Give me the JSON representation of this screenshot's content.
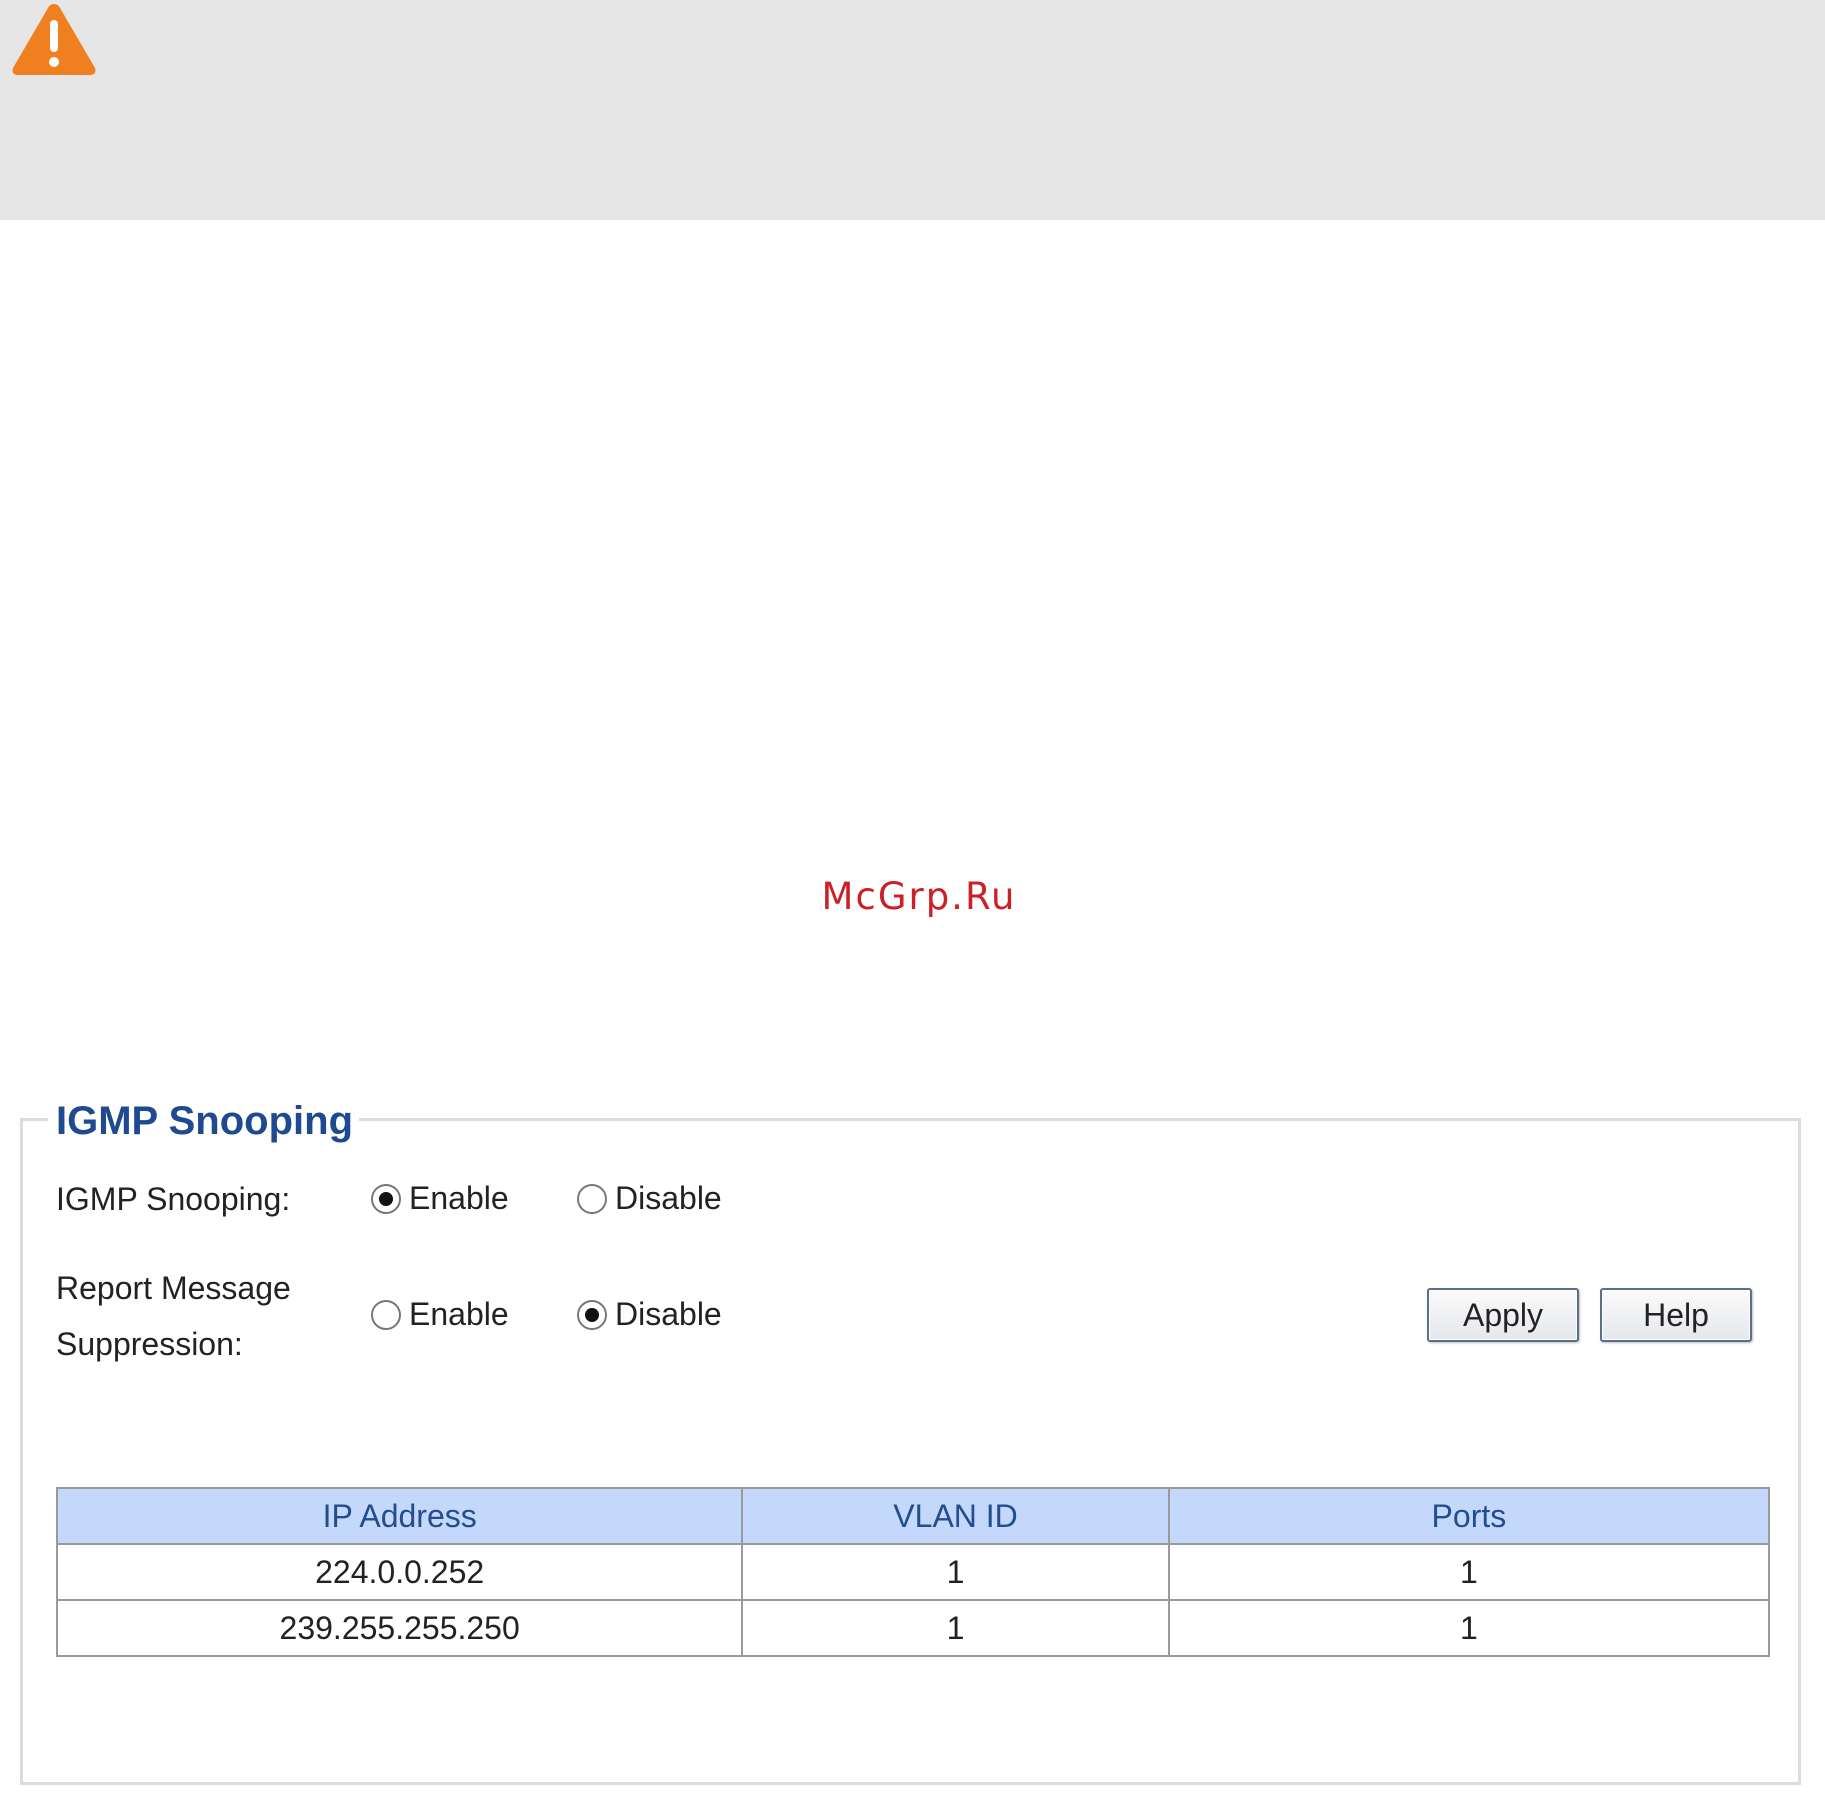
{
  "note": {
    "icon": "warning-icon",
    "accent": "#f07f1f"
  },
  "watermark": "McGrp.Ru",
  "panel": {
    "title": "IGMP Snooping",
    "igmp_snooping": {
      "label": "IGMP Snooping:",
      "options": [
        "Enable",
        "Disable"
      ],
      "selected": "Enable"
    },
    "report_suppression": {
      "label": "Report Message Suppression:",
      "options": [
        "Enable",
        "Disable"
      ],
      "selected": "Disable"
    },
    "buttons": {
      "apply": "Apply",
      "help": "Help"
    },
    "table": {
      "headers": [
        "IP Address",
        "VLAN ID",
        "Ports"
      ],
      "rows": [
        [
          "224.0.0.252",
          "1",
          "1"
        ],
        [
          "239.255.255.250",
          "1",
          "1"
        ]
      ]
    }
  },
  "colors": {
    "legend": "#1f4a8f",
    "header_bg": "#c4d8fb",
    "header_text": "#234d8f",
    "watermark": "#cc2027"
  }
}
